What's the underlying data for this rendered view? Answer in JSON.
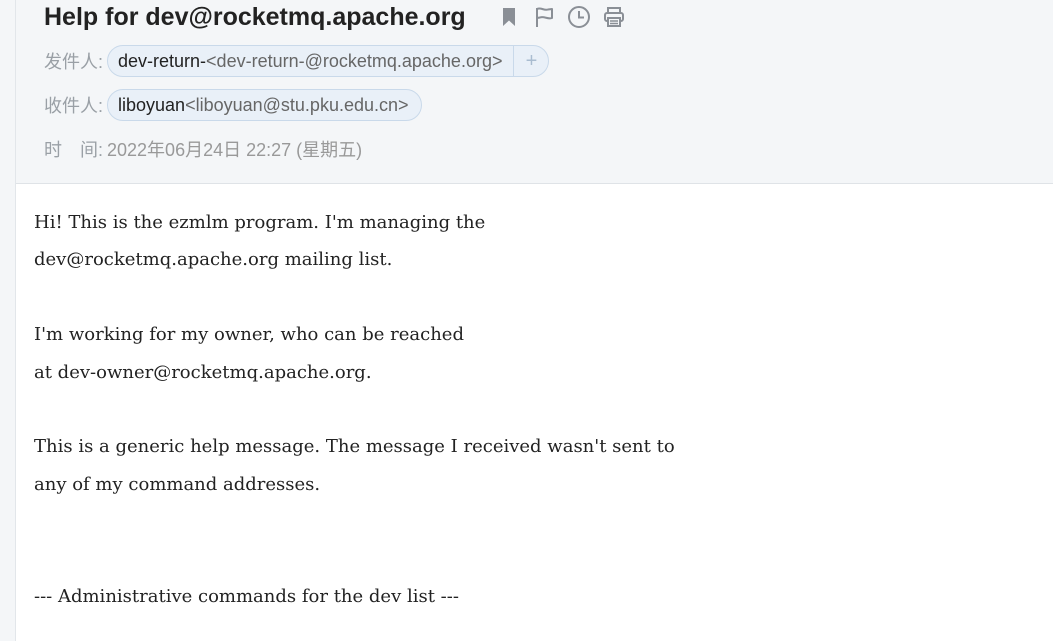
{
  "subject": "Help for dev@rocketmq.apache.org",
  "toolbar_icons": [
    "bookmark-icon",
    "flag-icon",
    "clock-icon",
    "print-icon"
  ],
  "from": {
    "label": "发件人:",
    "name": "dev-return-",
    "address": "<dev-return-@rocketmq.apache.org>",
    "add_symbol": "+"
  },
  "to": {
    "label": "收件人:",
    "name": "liboyuan",
    "address": "<liboyuan@stu.pku.edu.cn>"
  },
  "time": {
    "label": "时　间:",
    "value": "2022年06月24日 22:27 (星期五)"
  },
  "body_lines": [
    "Hi! This is the ezmlm program. I'm managing the",
    "dev@rocketmq.apache.org mailing list.",
    "",
    "I'm working for my owner, who can be reached",
    "at dev-owner@rocketmq.apache.org.",
    "",
    "This is a generic help message. The message I received wasn't sent to",
    "any of my command addresses.",
    "",
    "",
    "--- Administrative commands for the dev list ---"
  ],
  "colors": {
    "header_bg": "#f4f6f8",
    "chip_bg": "#e9f0f8",
    "chip_border": "#c9d9ea",
    "icon": "#8a8f96"
  }
}
